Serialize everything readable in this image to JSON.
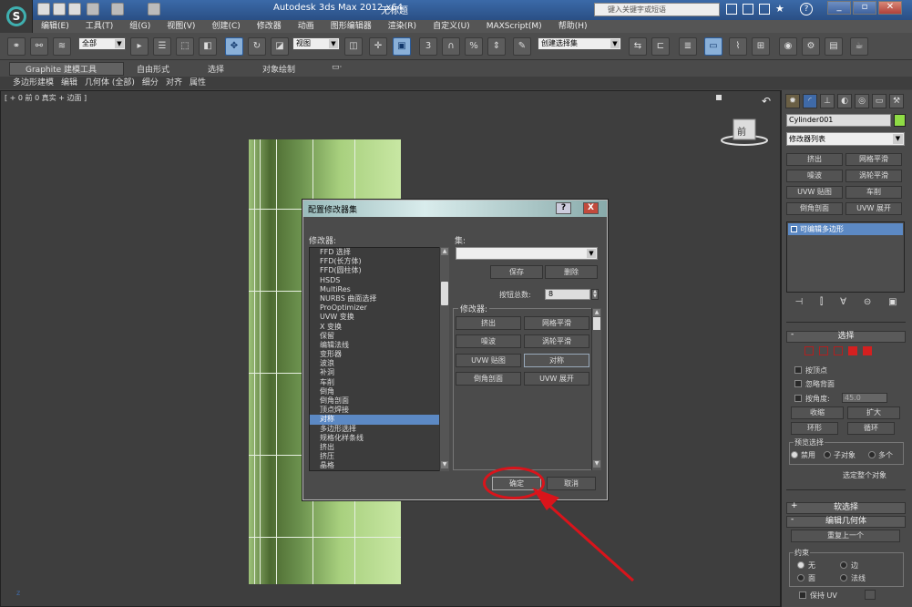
{
  "title_bar": {
    "app_name": "Autodesk 3ds Max  2012 x64",
    "file_name": "无标题",
    "search_placeholder": "键入关键字或短语",
    "help_label": "?"
  },
  "menu": [
    "编辑(E)",
    "工具(T)",
    "组(G)",
    "视图(V)",
    "创建(C)",
    "修改器",
    "动画",
    "图形编辑器",
    "渲染(R)",
    "自定义(U)",
    "MAXScript(M)",
    "帮助(H)"
  ],
  "toolbar": {
    "selection_filter": "全部",
    "ref_coord": "视图",
    "named_selection": "创建选择集",
    "snap_label": "3",
    "percent_label": "%"
  },
  "ribbon": {
    "tabs": [
      "Graphite 建模工具",
      "自由形式",
      "选择",
      "对象绘制"
    ],
    "sub_tabs": [
      "多边形建模",
      "编辑",
      "几何体 (全部)",
      "细分",
      "对齐",
      "属性"
    ]
  },
  "viewport": {
    "label": "[ + 0 前 0 真实 + 边面 ]",
    "cube_label": "前"
  },
  "command_panel": {
    "object_name": "Cylinder001",
    "modifier_list": "修改器列表",
    "modifier_buttons": [
      "挤出",
      "网格平滑",
      "噪波",
      "涡轮平滑",
      "UVW 贴图",
      "车削",
      "倒角剖面",
      "UVW 展开"
    ],
    "stack_item": "可编辑多边形",
    "rollouts": {
      "selection": "选择",
      "soft_selection": "软选择",
      "edit_geometry": "编辑几何体"
    },
    "by_vertex": "按顶点",
    "ignore_backfacing": "忽略背面",
    "by_angle": "按角度:",
    "angle_value": "45.0",
    "shrink": "收缩",
    "grow": "扩大",
    "ring": "环形",
    "loop": "循环",
    "preview_selection": "预览选择",
    "preview_options": [
      "禁用",
      "子对象",
      "多个"
    ],
    "select_whole": "选定整个对象",
    "repeat_last": "重复上一个",
    "constraints": "约束",
    "constraint_options": [
      "无",
      "边",
      "面",
      "法线"
    ],
    "preserve_uv": "保持 UV"
  },
  "dialog": {
    "title": "配置修改器集",
    "help": "?",
    "close": "X",
    "modifiers_label": "修改器:",
    "modifiers": [
      "FFD 选择",
      "FFD(长方体)",
      "FFD(圆柱体)",
      "HSDS",
      "MultiRes",
      "NURBS 曲面选择",
      "ProOptimizer",
      "UVW 变换",
      "X 变换",
      "保留",
      "编辑法线",
      "变形器",
      "波浪",
      "补洞",
      "车削",
      "倒角",
      "倒角剖面",
      "顶点焊接",
      "对称",
      "多边形选择",
      "规格化样条线",
      "挤出",
      "挤压",
      "晶格"
    ],
    "selected_modifier": "对称",
    "sets_label": "集:",
    "save": "保存",
    "delete": "删除",
    "button_count_label": "按钮总数:",
    "button_count": "8",
    "modifiers_group_label": "修改器:",
    "set_buttons": [
      "挤出",
      "网格平滑",
      "噪波",
      "涡轮平滑",
      "UVW 贴图",
      "对称",
      "倒角剖面",
      "UVW 展开"
    ],
    "ok": "确定",
    "cancel": "取消"
  },
  "colors": {
    "object_color": "#8fdc45",
    "selection": "#5c89c4",
    "annotation": "#d9141b"
  }
}
